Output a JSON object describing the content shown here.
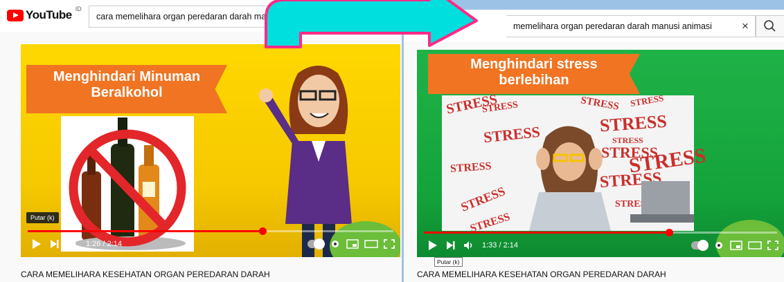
{
  "left": {
    "logo_text": "YouTube",
    "logo_region": "ID",
    "search_value": "cara memelihara organ peredaran darah manusi",
    "clear_glyph": "×",
    "banner_line1": "Menghindari Minuman",
    "banner_line2": "Beralkohol",
    "tooltip": "Putar (k)",
    "time": "1:26 / 2:14",
    "progress_fraction": 0.642,
    "title": "CARA MEMELIHARA KESEHATAN ORGAN PEREDARAN DARAH"
  },
  "right": {
    "search_value": "memelihara organ peredaran darah manusi animasi",
    "clear_glyph": "×",
    "banner_line1": "Menghindari stress",
    "banner_line2": "berlebihan",
    "tooltip": "Putar (k)",
    "time": "1:33 / 2:14",
    "progress_fraction": 0.694,
    "title": "CARA MEMELIHARA KESEHATAN ORGAN PEREDARAN DARAH",
    "stress_words": [
      "STRESS",
      "STRESS",
      "STRESS",
      "STRESS",
      "STRESS",
      "STRESS",
      "STRESS",
      "STRESS",
      "STRESS",
      "STRESS",
      "STRESS",
      "STRESS",
      "STRESS",
      "STRESS"
    ]
  },
  "colors": {
    "brand_red": "#ff0000",
    "arrow_fill": "#00dede",
    "arrow_stroke": "#ff2a86",
    "banner_orange": "#f07422",
    "left_bg": "#ffd700",
    "right_bg": "#1fb247"
  },
  "icons": [
    "youtube-logo-icon",
    "close-icon",
    "search-icon",
    "play-icon",
    "next-icon",
    "volume-icon",
    "autoplay-toggle-icon",
    "settings-gear-icon",
    "miniplayer-icon",
    "theater-mode-icon",
    "fullscreen-icon",
    "transition-arrow-icon"
  ]
}
